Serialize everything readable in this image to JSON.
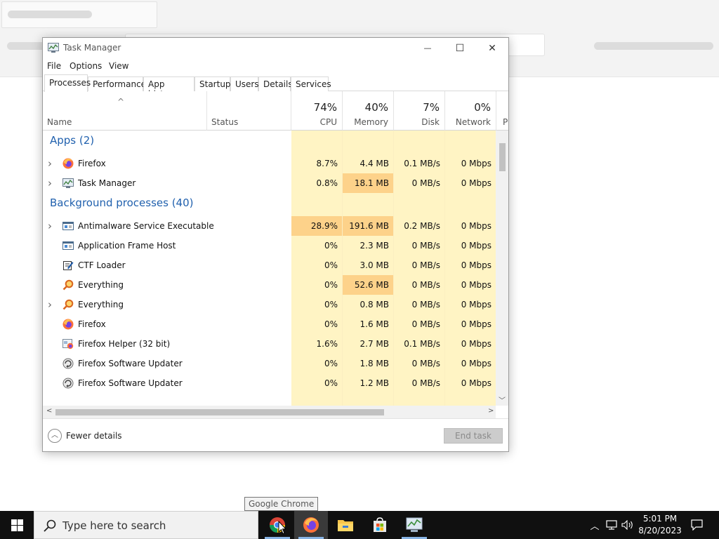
{
  "window": {
    "title": "Task Manager",
    "controls": {
      "minimize": "—",
      "maximize": "☐",
      "close": "✕"
    }
  },
  "menu": [
    "File",
    "Options",
    "View"
  ],
  "tabs": [
    "Processes",
    "Performance",
    "App history",
    "Startup",
    "Users",
    "Details",
    "Services"
  ],
  "active_tab": "Processes",
  "columns": {
    "name": "Name",
    "status": "Status",
    "cpu": {
      "pct": "74%",
      "label": "CPU"
    },
    "memory": {
      "pct": "40%",
      "label": "Memory"
    },
    "disk": {
      "pct": "7%",
      "label": "Disk"
    },
    "network": {
      "pct": "0%",
      "label": "Network"
    },
    "power_cut": "P",
    "sort_indicator": "^"
  },
  "groups": {
    "apps": "Apps (2)",
    "background": "Background processes (40)"
  },
  "apps": [
    {
      "name": "Firefox",
      "cpu": "8.7%",
      "memory": "4.4 MB",
      "disk": "0.1 MB/s",
      "network": "0 Mbps",
      "expandable": true,
      "icon": "firefox-icon"
    },
    {
      "name": "Task Manager",
      "cpu": "0.8%",
      "memory": "18.1 MB",
      "disk": "0 MB/s",
      "network": "0 Mbps",
      "expandable": true,
      "icon": "task-manager-icon"
    }
  ],
  "background": [
    {
      "name": "Antimalware Service Executable",
      "cpu": "28.9%",
      "memory": "191.6 MB",
      "disk": "0.2 MB/s",
      "network": "0 Mbps",
      "expandable": true,
      "icon": "service-window-icon"
    },
    {
      "name": "Application Frame Host",
      "cpu": "0%",
      "memory": "2.3 MB",
      "disk": "0 MB/s",
      "network": "0 Mbps",
      "expandable": false,
      "icon": "service-window-icon"
    },
    {
      "name": "CTF Loader",
      "cpu": "0%",
      "memory": "3.0 MB",
      "disk": "0 MB/s",
      "network": "0 Mbps",
      "expandable": false,
      "icon": "ctf-loader-icon"
    },
    {
      "name": "Everything",
      "cpu": "0%",
      "memory": "52.6 MB",
      "disk": "0 MB/s",
      "network": "0 Mbps",
      "expandable": false,
      "icon": "everything-icon"
    },
    {
      "name": "Everything",
      "cpu": "0%",
      "memory": "0.8 MB",
      "disk": "0 MB/s",
      "network": "0 Mbps",
      "expandable": true,
      "icon": "everything-icon"
    },
    {
      "name": "Firefox",
      "cpu": "0%",
      "memory": "1.6 MB",
      "disk": "0 MB/s",
      "network": "0 Mbps",
      "expandable": false,
      "icon": "firefox-icon"
    },
    {
      "name": "Firefox Helper (32 bit)",
      "cpu": "1.6%",
      "memory": "2.7 MB",
      "disk": "0.1 MB/s",
      "network": "0 Mbps",
      "expandable": false,
      "icon": "firefox-helper-icon"
    },
    {
      "name": "Firefox Software Updater",
      "cpu": "0%",
      "memory": "1.8 MB",
      "disk": "0 MB/s",
      "network": "0 Mbps",
      "expandable": false,
      "icon": "updater-icon"
    },
    {
      "name": "Firefox Software Updater",
      "cpu": "0%",
      "memory": "1.2 MB",
      "disk": "0 MB/s",
      "network": "0 Mbps",
      "expandable": false,
      "icon": "updater-icon"
    }
  ],
  "footer": {
    "fewer_details": "Fewer details",
    "end_task": "End task"
  },
  "tooltip": "Google Chrome",
  "taskbar": {
    "search_placeholder": "Type here to search",
    "time": "5:01 PM",
    "date": "8/20/2023",
    "pinned": [
      "chrome-icon",
      "firefox-icon",
      "file-explorer-icon",
      "store-icon",
      "task-manager-icon"
    ]
  },
  "colors": {
    "group_label": "#2161ae",
    "heat_light": "#fff4c4",
    "heat_med": "#fde9a7",
    "heat_high": "#fdd28a",
    "taskbar": "#101010"
  }
}
